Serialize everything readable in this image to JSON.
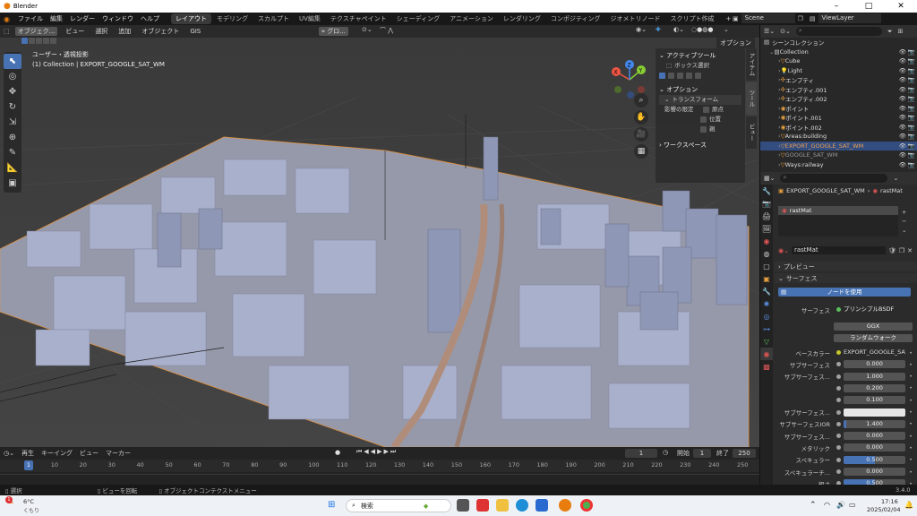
{
  "window": {
    "title": "Blender"
  },
  "menubar": {
    "menus": [
      "ファイル",
      "編集",
      "レンダー",
      "ウィンドウ",
      "ヘルプ"
    ],
    "workspaces": [
      "レイアウト",
      "モデリング",
      "スカルプト",
      "UV編集",
      "テクスチャペイント",
      "シェーディング",
      "アニメーション",
      "レンダリング",
      "コンポジティング",
      "ジオメトリノード",
      "スクリプト作成"
    ],
    "add_tab": "+",
    "scene": "Scene",
    "view_layer": "ViewLayer"
  },
  "viewport": {
    "mode": "オブジェク...",
    "menus": [
      "ビュー",
      "選択",
      "追加",
      "オブジェクト",
      "GIS"
    ],
    "transform_orient": "グロ...",
    "options": "オプション",
    "view_name": "ユーザー・透視投影",
    "collection_info": "(1) Collection | EXPORT_GOOGLE_SAT_WM",
    "gizmo_axes": [
      "X",
      "Y",
      "Z"
    ]
  },
  "sidepanel": {
    "active_tool": "アクティブツール",
    "box_select": "ボックス選択",
    "options": "オプション",
    "transform": "トランスフォーム",
    "affect_only": "影響の限定",
    "origins": "原点",
    "locations": "位置",
    "parents": "親",
    "workspace": "ワークスペース",
    "tabs": [
      "アイテム",
      "ツール",
      "ビュー"
    ]
  },
  "outliner": {
    "header": "シーンコレクション",
    "rows": [
      {
        "name": "Collection",
        "indent": 1,
        "color": "#ddd",
        "sel": false
      },
      {
        "name": "Cube",
        "indent": 2,
        "color": "#ddd",
        "sel": false
      },
      {
        "name": "Light",
        "indent": 2,
        "color": "#ddd",
        "sel": false
      },
      {
        "name": "エンプティ",
        "indent": 2,
        "color": "#ddd",
        "sel": false
      },
      {
        "name": "エンプティ.001",
        "indent": 2,
        "color": "#ddd",
        "sel": false
      },
      {
        "name": "エンプティ.002",
        "indent": 2,
        "color": "#ddd",
        "sel": false
      },
      {
        "name": "ポイント",
        "indent": 2,
        "color": "#ddd",
        "sel": false
      },
      {
        "name": "ポイント.001",
        "indent": 2,
        "color": "#ddd",
        "sel": false
      },
      {
        "name": "ポイント.002",
        "indent": 2,
        "color": "#ddd",
        "sel": false
      },
      {
        "name": "Areas:building",
        "indent": 2,
        "color": "#ddd",
        "sel": false
      },
      {
        "name": "EXPORT_GOOGLE_SAT_WM",
        "indent": 2,
        "color": "#f0a050",
        "sel": true
      },
      {
        "name": "GOOGLE_SAT_WM",
        "indent": 2,
        "color": "#999",
        "sel": false
      },
      {
        "name": "Ways:railway",
        "indent": 2,
        "color": "#ddd",
        "sel": false
      }
    ]
  },
  "properties": {
    "object": "EXPORT_GOOGLE_SAT_WM",
    "material_slot": "rastMat",
    "material_list_item": "rastMat",
    "material_name": "rastMat",
    "preview": "プレビュー",
    "surface_panel": "サーフェス",
    "use_nodes": "ノードを使用",
    "surface_label": "サーフェス",
    "surface_value": "プリンシプルBSDF",
    "distribution": "GGX",
    "subsurface_method": "ランダムウォーク",
    "fields": [
      {
        "label": "ベースカラー",
        "value": "EXPORT_GOOGLE_SAT...",
        "kind": "link"
      },
      {
        "label": "サブサーフェス",
        "value": "0.000",
        "kind": "num",
        "fill": 0
      },
      {
        "label": "サブサーフェス...",
        "value": "1.000",
        "kind": "num",
        "fill": 0
      },
      {
        "label": "",
        "value": "0.200",
        "kind": "num",
        "fill": 0
      },
      {
        "label": "",
        "value": "0.100",
        "kind": "num",
        "fill": 0
      },
      {
        "label": "サブサーフェス...",
        "value": "",
        "kind": "color"
      },
      {
        "label": "サブサーフェスIOR",
        "value": "1.400",
        "kind": "num",
        "fill": 0.05
      },
      {
        "label": "サブサーフェス...",
        "value": "0.000",
        "kind": "num",
        "fill": 0
      },
      {
        "label": "メタリック",
        "value": "0.000",
        "kind": "num",
        "fill": 0
      },
      {
        "label": "スペキュラー",
        "value": "0.500",
        "kind": "num",
        "fill": 0.5
      },
      {
        "label": "スペキュラーチ...",
        "value": "0.000",
        "kind": "num",
        "fill": 0
      },
      {
        "label": "粗さ",
        "value": "0.500",
        "kind": "num",
        "fill": 0.5
      }
    ]
  },
  "timeline": {
    "playback": "再生",
    "keying": "キーイング",
    "view": "ビュー",
    "marker": "マーカー",
    "current_frame": "1",
    "start_label": "開始",
    "start": "1",
    "end_label": "終了",
    "end": "250",
    "ticks": [
      "1",
      "10",
      "20",
      "30",
      "40",
      "50",
      "60",
      "70",
      "80",
      "90",
      "100",
      "110",
      "120",
      "130",
      "140",
      "150",
      "160",
      "170",
      "180",
      "190",
      "200",
      "210",
      "220",
      "230",
      "240",
      "250"
    ]
  },
  "statusbar": {
    "select": "選択",
    "rotate": "ビューを回転",
    "context_menu": "オブジェクトコンテクストメニュー",
    "version": "3.4.0"
  },
  "taskbar": {
    "weather_temp": "6°C",
    "weather_desc": "くもり",
    "search": "検索",
    "time": "17:16",
    "date": "2025/02/04",
    "notification_count": "1"
  }
}
